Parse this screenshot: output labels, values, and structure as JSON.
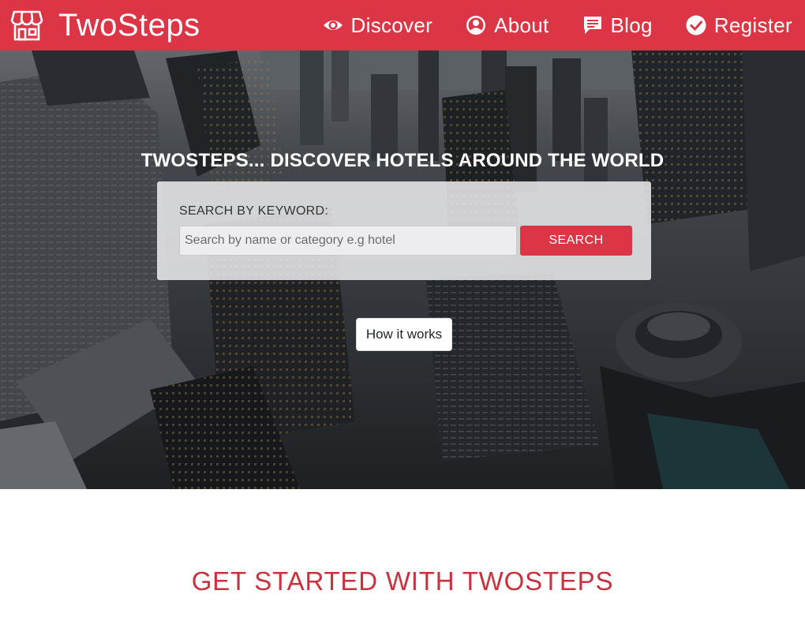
{
  "brand": {
    "name": "TwoSteps",
    "icon": "store-icon"
  },
  "nav": {
    "items": [
      {
        "label": "Discover",
        "icon": "eye-icon"
      },
      {
        "label": "About",
        "icon": "user-circle-icon"
      },
      {
        "label": "Blog",
        "icon": "comment-icon"
      },
      {
        "label": "Register",
        "icon": "check-circle-icon"
      }
    ]
  },
  "hero": {
    "title": "TWOSTEPS... DISCOVER HOTELS AROUND THE WORLD",
    "search": {
      "label": "SEARCH BY KEYWORD:",
      "placeholder": "Search by name or category e.g hotel",
      "value": "",
      "button": "SEARCH"
    },
    "how_button": "How it works"
  },
  "section": {
    "title": "GET STARTED WITH TWOSTEPS"
  },
  "colors": {
    "primary": "#dc3545",
    "heading": "#c8323f",
    "white": "#ffffff"
  }
}
